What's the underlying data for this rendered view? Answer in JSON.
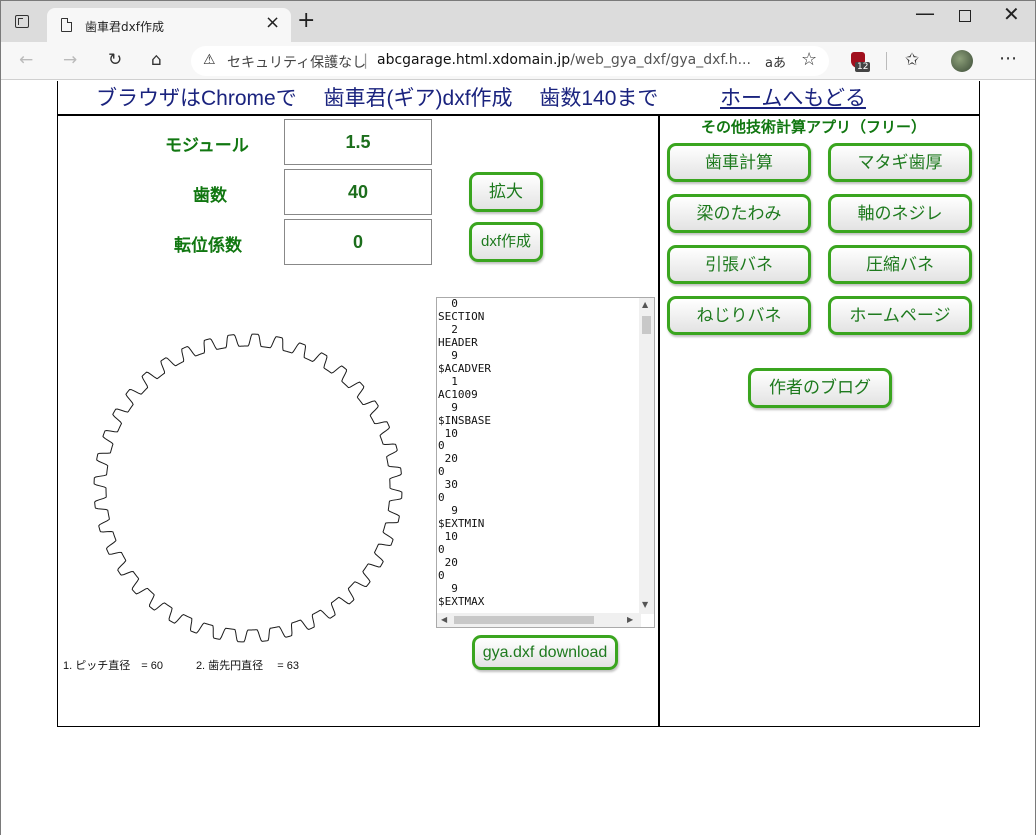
{
  "browser": {
    "tab_title": "歯車君dxf作成",
    "security_label": "セキュリティ保護なし",
    "url_host": "abcgarage.html.xdomain.jp",
    "url_path": "/web_gya_dxf/gya_dxf.h...",
    "read_aloud_label": "aあ",
    "extension_badge": "12"
  },
  "header": {
    "title": "ブラウザはChromeで　 歯車君(ギア)dxf作成　 歯数140まで",
    "home_link": "ホームへもどる"
  },
  "params": [
    {
      "label": "モジュール",
      "value": "1.5"
    },
    {
      "label": "歯数",
      "value": "40"
    },
    {
      "label": "転位係数",
      "value": "0"
    }
  ],
  "buttons": {
    "zoom": "拡大",
    "dxf_create": "dxf作成",
    "download": "gya.dxf download"
  },
  "dxf_output": "  0\nSECTION\n  2\nHEADER\n  9\n$ACADVER\n  1\nAC1009\n  9\n$INSBASE\n 10\n0\n 20\n0\n 30\n0\n  9\n$EXTMIN\n 10\n0\n 20\n0\n  9\n$EXTMAX",
  "info": "1. ピッチ直径　= 60　　　2. 歯先円直径　 = 63",
  "gear": {
    "teeth": 40,
    "module": 1.5,
    "stroke_color": "#1a1a1a"
  },
  "apps": {
    "title": "その他技術計算アプリ（フリー）",
    "items": [
      "歯車計算",
      "マタギ歯厚",
      "梁のたわみ",
      "軸のネジレ",
      "引張バネ",
      "圧縮バネ",
      "ねじりバネ",
      "ホームページ"
    ],
    "blog": "作者のブログ"
  },
  "colors": {
    "accent_green": "#3aa51f",
    "text_green": "#117711",
    "header_navy": "#1a237e"
  }
}
